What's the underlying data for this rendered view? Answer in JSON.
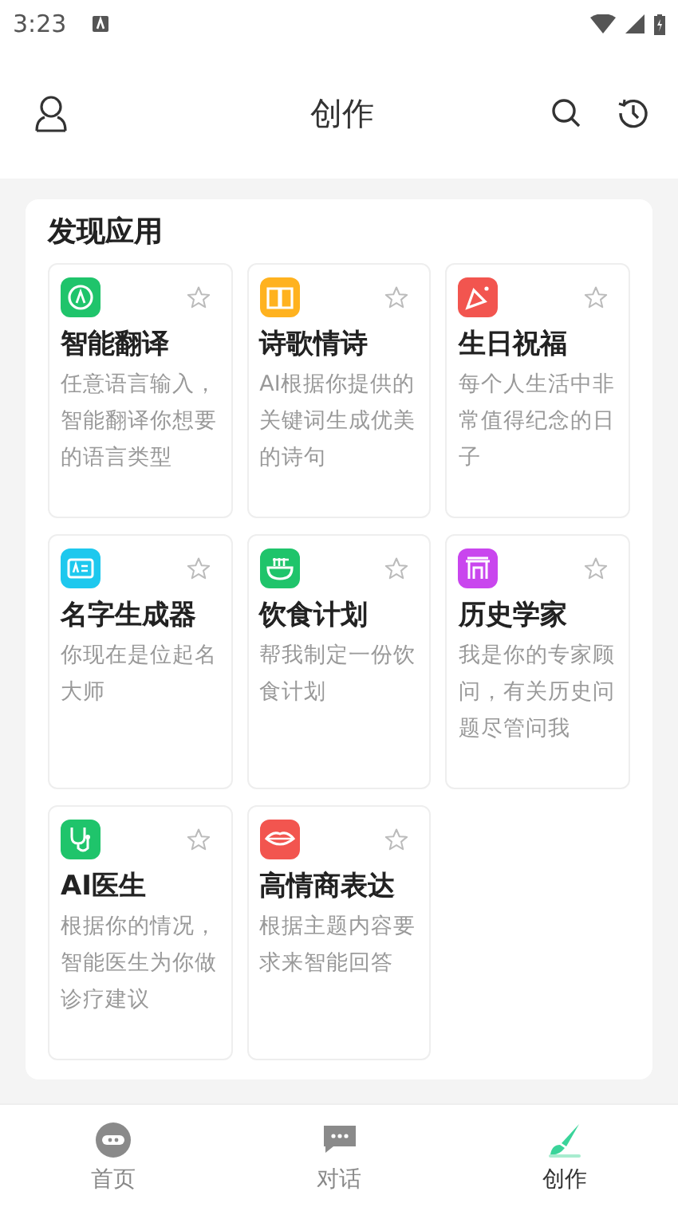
{
  "status_bar": {
    "time": "3:23"
  },
  "header": {
    "title": "创作"
  },
  "section": {
    "title": "发现应用"
  },
  "apps": [
    {
      "name": "智能翻译",
      "description": "任意语言输入，智能翻译你想要的语言类型",
      "color": "#1fc46b",
      "favorite": false
    },
    {
      "name": "诗歌情诗",
      "description": "AI根据你提供的关键词生成优美的诗句",
      "color": "#ffb21f",
      "favorite": false
    },
    {
      "name": "生日祝福",
      "description": "每个人生活中非常值得纪念的日子",
      "color": "#f2554f",
      "favorite": false
    },
    {
      "name": "名字生成器",
      "description": "你现在是位起名大师",
      "color": "#1ec8ee",
      "favorite": false
    },
    {
      "name": "饮食计划",
      "description": "帮我制定一份饮食计划",
      "color": "#1fc46b",
      "favorite": false
    },
    {
      "name": "历史学家",
      "description": "我是你的专家顾问，有关历史问题尽管问我",
      "color": "#c946ee",
      "favorite": false
    },
    {
      "name": "AI医生",
      "description": "根据你的情况，智能医生为你做诊疗建议",
      "color": "#1fc46b",
      "favorite": false
    },
    {
      "name": "高情商表达",
      "description": "根据主题内容要求来智能回答",
      "color": "#f2554f",
      "favorite": false
    }
  ],
  "tabs": [
    {
      "label": "首页",
      "selected": false
    },
    {
      "label": "对话",
      "selected": false
    },
    {
      "label": "创作",
      "selected": true
    }
  ]
}
